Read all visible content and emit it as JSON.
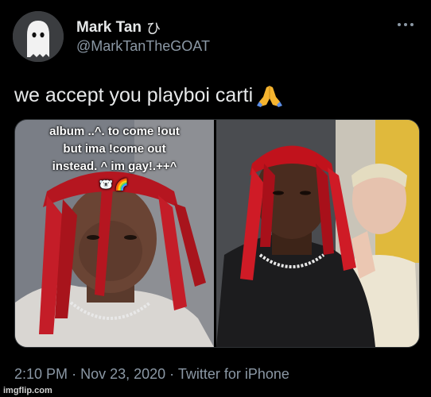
{
  "author": {
    "display_name": "Mark Tan",
    "name_glyph": "ひ",
    "handle": "@MarkTanTheGOAT",
    "avatar_icon": "ghost-avatar-icon"
  },
  "menu_icon": "more-horizontal-icon",
  "tweet": {
    "text": "we accept you playboi carti",
    "emoji_icon": "folded-hands-icon"
  },
  "media": {
    "caption_lines": [
      "album ..^. to come !out",
      "but ima !come out",
      "instead. ^ im gay!.++^"
    ],
    "caption_emoji": "🐻‍❄️🌈"
  },
  "meta": {
    "time": "2:10 PM",
    "date": "Nov 23, 2020",
    "source": "Twitter for iPhone",
    "separator": "·"
  },
  "watermark": "imgflip.com",
  "colors": {
    "background": "#000000",
    "text": "#e7e9ea",
    "secondary": "#8b98a5",
    "border": "#2f3336"
  }
}
